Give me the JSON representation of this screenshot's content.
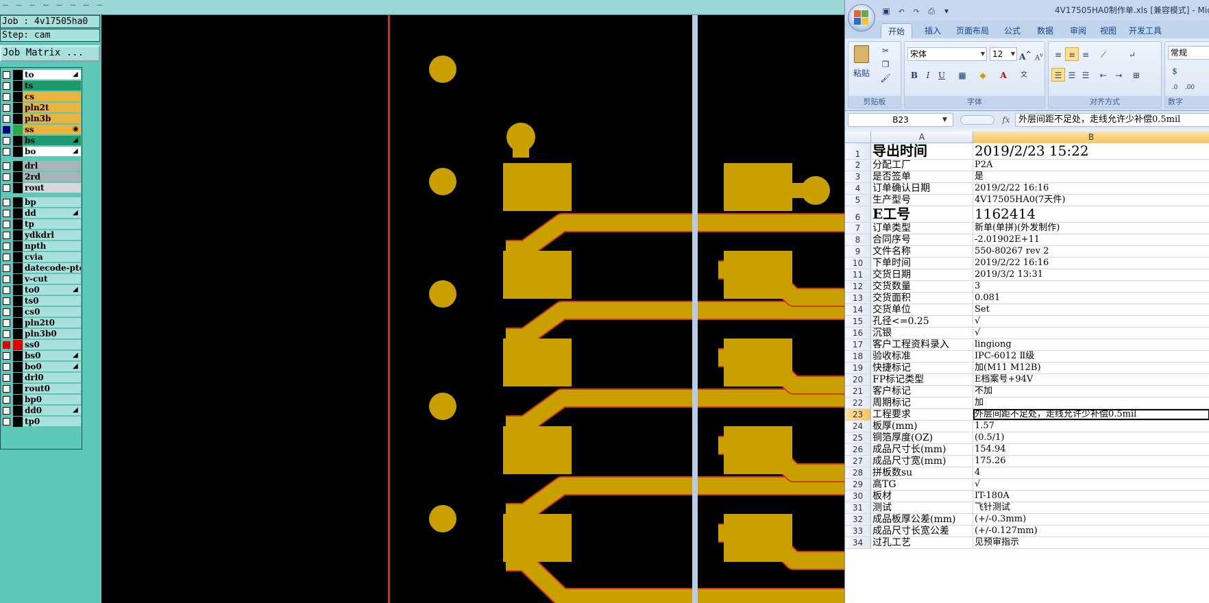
{
  "cam": {
    "menubar_text": "_ _ _ _ _ _ _ _",
    "job_label": "Job : 4v17505ha0",
    "step_label": "Step: cam",
    "job_matrix_button": "Job Matrix ...",
    "layers": [
      {
        "name": "to",
        "bg": "#ffffff",
        "mark": "◢",
        "cb": "off",
        "sw": "#000000"
      },
      {
        "name": "ts",
        "bg": "#1f9a6e",
        "mark": "",
        "cb": "off",
        "sw": "#000000"
      },
      {
        "name": "cs",
        "bg": "#e9b33d",
        "mark": "",
        "cb": "off",
        "sw": "#000000"
      },
      {
        "name": "pln2t",
        "bg": "#e9b33d",
        "mark": "",
        "cb": "off",
        "sw": "#000000"
      },
      {
        "name": "pln3b",
        "bg": "#e9b33d",
        "mark": "",
        "cb": "off",
        "sw": "#000000"
      },
      {
        "name": "ss",
        "bg": "#e9b33d",
        "mark": "◉",
        "cb": "on",
        "sw": "#2ea84a"
      },
      {
        "name": "bs",
        "bg": "#1f9a6e",
        "mark": "◢",
        "cb": "off",
        "sw": "#000000"
      },
      {
        "name": "bo",
        "bg": "#ffffff",
        "mark": "◢",
        "cb": "off",
        "sw": "#000000"
      },
      {
        "name": "drl",
        "bg": "#a8b4b8",
        "mark": "",
        "cb": "off",
        "sw": "#000000",
        "gap": true
      },
      {
        "name": "2rd",
        "bg": "#a8b4b8",
        "mark": "",
        "cb": "off",
        "sw": "#000000"
      },
      {
        "name": "rout",
        "bg": "#d8d8d8",
        "mark": "",
        "cb": "off",
        "sw": "#000000"
      },
      {
        "name": "bp",
        "bg": "#a8e0dc",
        "mark": "",
        "cb": "off",
        "sw": "#000000",
        "gap": true
      },
      {
        "name": "dd",
        "bg": "#a8e0dc",
        "mark": "◢",
        "cb": "off",
        "sw": "#000000"
      },
      {
        "name": "tp",
        "bg": "#a8e0dc",
        "mark": "",
        "cb": "off",
        "sw": "#000000"
      },
      {
        "name": "ydkdrl",
        "bg": "#a8e0dc",
        "mark": "",
        "cb": "off",
        "sw": "#000000"
      },
      {
        "name": "npth",
        "bg": "#a8e0dc",
        "mark": "",
        "cb": "off",
        "sw": "#000000"
      },
      {
        "name": "cvia",
        "bg": "#a8e0dc",
        "mark": "",
        "cb": "off",
        "sw": "#000000"
      },
      {
        "name": "datecode-pte",
        "bg": "#a8e0dc",
        "mark": "",
        "cb": "off",
        "sw": "#000000"
      },
      {
        "name": "v-cut",
        "bg": "#a8e0dc",
        "mark": "",
        "cb": "off",
        "sw": "#000000"
      },
      {
        "name": "to0",
        "bg": "#a8e0dc",
        "mark": "◢",
        "cb": "off",
        "sw": "#000000"
      },
      {
        "name": "ts0",
        "bg": "#a8e0dc",
        "mark": "",
        "cb": "off",
        "sw": "#000000"
      },
      {
        "name": "cs0",
        "bg": "#a8e0dc",
        "mark": "",
        "cb": "off",
        "sw": "#000000"
      },
      {
        "name": "pln2t0",
        "bg": "#a8e0dc",
        "mark": "",
        "cb": "off",
        "sw": "#000000"
      },
      {
        "name": "pln3b0",
        "bg": "#a8e0dc",
        "mark": "",
        "cb": "off",
        "sw": "#000000"
      },
      {
        "name": "ss0",
        "bg": "#a8e0dc",
        "mark": "",
        "cb": "red",
        "sw": "#e00000"
      },
      {
        "name": "bs0",
        "bg": "#a8e0dc",
        "mark": "◢",
        "cb": "off",
        "sw": "#000000"
      },
      {
        "name": "bo0",
        "bg": "#a8e0dc",
        "mark": "◢",
        "cb": "off",
        "sw": "#000000"
      },
      {
        "name": "drl0",
        "bg": "#a8e0dc",
        "mark": "",
        "cb": "off",
        "sw": "#000000"
      },
      {
        "name": "rout0",
        "bg": "#a8e0dc",
        "mark": "",
        "cb": "off",
        "sw": "#000000"
      },
      {
        "name": "bp0",
        "bg": "#a8e0dc",
        "mark": "",
        "cb": "off",
        "sw": "#000000"
      },
      {
        "name": "dd0",
        "bg": "#a8e0dc",
        "mark": "◢",
        "cb": "off",
        "sw": "#000000"
      },
      {
        "name": "tp0",
        "bg": "#a8e0dc",
        "mark": "",
        "cb": "off",
        "sw": "#000000"
      }
    ],
    "colors": {
      "copper": "#c9a000",
      "trace_edge": "#d23a1a",
      "cursor_line": "#b8cce8",
      "red_line": "#c83030"
    }
  },
  "excel": {
    "title": "4V17505HA0制作单.xls [兼容模式] - Mic",
    "tabs": [
      "开始",
      "插入",
      "页面布局",
      "公式",
      "数据",
      "审阅",
      "视图",
      "开发工具"
    ],
    "ribbon": {
      "clipboard_label": "剪贴板",
      "paste_label": "粘贴",
      "font_label": "字体",
      "font_name": "宋体",
      "font_size": "12",
      "align_label": "对齐方式",
      "number_label": "数字",
      "number_format": "常规"
    },
    "name_box": "B23",
    "fx": "fx",
    "formula_content": "外层间距不足处，走线允许少补偿0.5mil",
    "columns": [
      "A",
      "B"
    ],
    "rows": [
      {
        "n": "1",
        "a": "导出时间",
        "b": "2019/2/23 15:22",
        "big": true
      },
      {
        "n": "2",
        "a": "分配工厂",
        "b": "P2A"
      },
      {
        "n": "3",
        "a": "是否签单",
        "b": "是"
      },
      {
        "n": "4",
        "a": "订单确认日期",
        "b": "2019/2/22 16:16"
      },
      {
        "n": "5",
        "a": "生产型号",
        "b": "4V17505HA0(7天件)"
      },
      {
        "n": "6",
        "a": "E工号",
        "b": "1162414",
        "big": true
      },
      {
        "n": "7",
        "a": "订单类型",
        "b": "新单(单拼)(外发制作)"
      },
      {
        "n": "8",
        "a": "合同序号",
        "b": "-2.01902E+11"
      },
      {
        "n": "9",
        "a": "文件名称",
        "b": "550-80267 rev 2"
      },
      {
        "n": "10",
        "a": "下单时间",
        "b": "2019/2/22 16:16"
      },
      {
        "n": "11",
        "a": "交货日期",
        "b": "2019/3/2 13:31"
      },
      {
        "n": "12",
        "a": "交货数量",
        "b": "3"
      },
      {
        "n": "13",
        "a": "交货面积",
        "b": "0.081"
      },
      {
        "n": "14",
        "a": "交货单位",
        "b": "Set"
      },
      {
        "n": "15",
        "a": "孔径<=0.25",
        "b": "√"
      },
      {
        "n": "16",
        "a": "沉银",
        "b": "√"
      },
      {
        "n": "17",
        "a": "客户工程资料录入",
        "b": "lingiong"
      },
      {
        "n": "18",
        "a": "验收标准",
        "b": "IPC-6012 Ⅱ级"
      },
      {
        "n": "19",
        "a": "快捷标记",
        "b": "加(M11 M12B)"
      },
      {
        "n": "20",
        "a": "FP标记类型",
        "b": "E档案号+94V"
      },
      {
        "n": "21",
        "a": "客户标记",
        "b": "不加"
      },
      {
        "n": "22",
        "a": "周期标记",
        "b": "加"
      },
      {
        "n": "23",
        "a": "工程要求",
        "b": "外层间距不足处，走线允许少补偿0.5mil",
        "sel": true
      },
      {
        "n": "24",
        "a": "板厚(mm)",
        "b": "1.57"
      },
      {
        "n": "25",
        "a": "铜箔厚度(OZ)",
        "b": "(0.5/1)"
      },
      {
        "n": "26",
        "a": "成品尺寸长(mm)",
        "b": "154.94"
      },
      {
        "n": "27",
        "a": "成品尺寸宽(mm)",
        "b": "175.26"
      },
      {
        "n": "28",
        "a": "拼板数su",
        "b": "4"
      },
      {
        "n": "29",
        "a": "高TG",
        "b": "√"
      },
      {
        "n": "30",
        "a": "板材",
        "b": "IT-180A"
      },
      {
        "n": "31",
        "a": "测试",
        "b": "飞针测试"
      },
      {
        "n": "32",
        "a": "成品板厚公差(mm)",
        "b": "(+/-0.3mm)"
      },
      {
        "n": "33",
        "a": "成品尺寸长宽公差",
        "b": "(+/-0.127mm)"
      },
      {
        "n": "34",
        "a": "过孔工艺",
        "b": "见预审指示"
      }
    ]
  }
}
